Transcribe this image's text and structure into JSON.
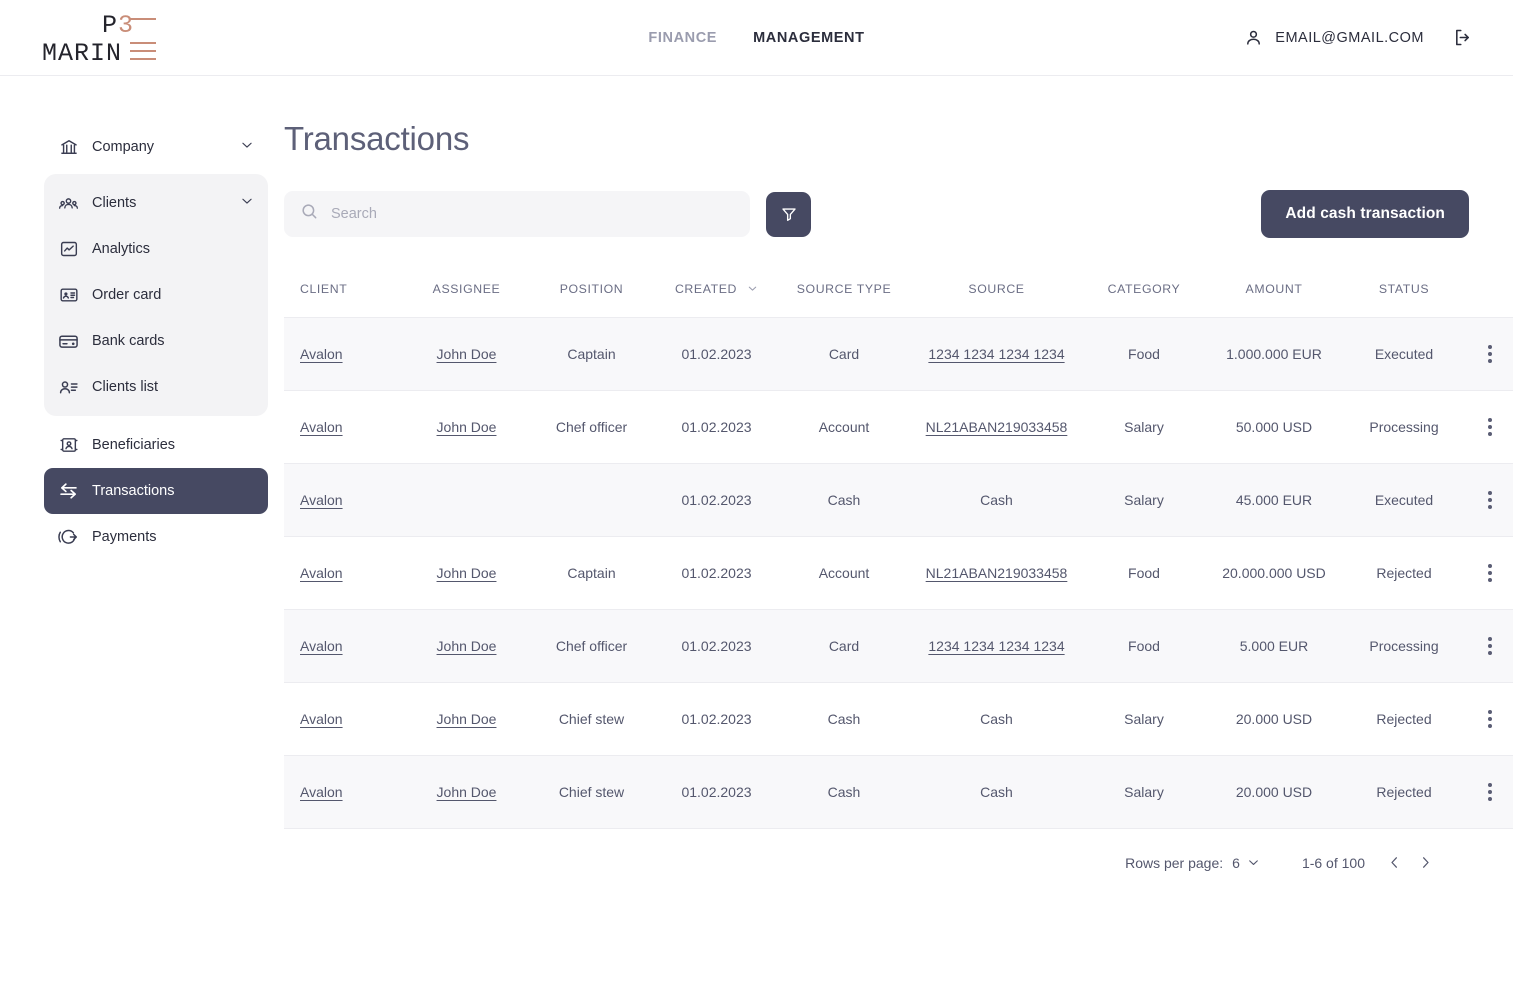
{
  "header": {
    "logo": {
      "top_text": "P3",
      "top_plain": "P",
      "top_accent": "3",
      "bottom_text": "MARIN",
      "accent_color": "#c98d78"
    },
    "nav": [
      {
        "label": "FINANCE",
        "active": false
      },
      {
        "label": "MANAGEMENT",
        "active": true
      }
    ],
    "user_email": "EMAIL@GMAIL.COM",
    "logout_icon": "logout-icon",
    "user_icon": "person-icon"
  },
  "sidebar": {
    "items": [
      {
        "label": "Company",
        "icon": "bank-icon",
        "expandable": true,
        "active": false
      },
      {
        "label": "Clients",
        "icon": "people-icon",
        "expandable": true,
        "active": false,
        "group": true
      },
      {
        "label": "Analytics",
        "icon": "analytics-icon",
        "expandable": false,
        "active": false,
        "group": true
      },
      {
        "label": "Order card",
        "icon": "id-card-icon",
        "expandable": false,
        "active": false,
        "group": true
      },
      {
        "label": "Bank cards",
        "icon": "credit-card-icon",
        "expandable": false,
        "active": false,
        "group": true
      },
      {
        "label": "Clients list",
        "icon": "user-list-icon",
        "expandable": false,
        "active": false,
        "group": true
      },
      {
        "label": "Beneficiaries",
        "icon": "beneficiary-icon",
        "expandable": false,
        "active": false
      },
      {
        "label": "Transactions",
        "icon": "transfer-icon",
        "expandable": false,
        "active": true
      },
      {
        "label": "Payments",
        "icon": "payments-icon",
        "expandable": false,
        "active": false
      }
    ]
  },
  "main": {
    "title": "Transactions",
    "search": {
      "placeholder": "Search",
      "value": "",
      "icon": "search-icon"
    },
    "filter_button": {
      "icon": "filter-icon"
    },
    "add_button": {
      "label": "Add cash transaction"
    },
    "table": {
      "columns": [
        {
          "key": "client",
          "label": "CLIENT",
          "sortable": false
        },
        {
          "key": "assignee",
          "label": "ASSIGNEE",
          "sortable": false
        },
        {
          "key": "position",
          "label": "POSITION",
          "sortable": false
        },
        {
          "key": "created",
          "label": "CREATED",
          "sortable": true
        },
        {
          "key": "source_type",
          "label": "SOURCE TYPE",
          "sortable": false
        },
        {
          "key": "source",
          "label": "SOURCE",
          "sortable": false
        },
        {
          "key": "category",
          "label": "CATEGORY",
          "sortable": false
        },
        {
          "key": "amount",
          "label": "AMOUNT",
          "sortable": false
        },
        {
          "key": "status",
          "label": "STATUS",
          "sortable": false
        }
      ],
      "rows": [
        {
          "client": "Avalon",
          "client_link": true,
          "assignee": "John Doe",
          "assignee_link": true,
          "position": "Captain",
          "created": "01.02.2023",
          "source_type": "Card",
          "source": "1234 1234 1234 1234",
          "source_link": true,
          "category": "Food",
          "amount": "1.000.000 EUR",
          "status": "Executed"
        },
        {
          "client": "Avalon",
          "client_link": true,
          "assignee": "John Doe",
          "assignee_link": true,
          "position": "Chef officer",
          "created": "01.02.2023",
          "source_type": "Account",
          "source": "NL21ABAN219033458",
          "source_link": true,
          "category": "Salary",
          "amount": "50.000 USD",
          "status": "Processing"
        },
        {
          "client": "Avalon",
          "client_link": true,
          "assignee": "",
          "assignee_link": false,
          "position": "",
          "created": "01.02.2023",
          "source_type": "Cash",
          "source": "Cash",
          "source_link": false,
          "category": "Salary",
          "amount": "45.000 EUR",
          "status": "Executed"
        },
        {
          "client": "Avalon",
          "client_link": true,
          "assignee": "John Doe",
          "assignee_link": true,
          "position": "Captain",
          "created": "01.02.2023",
          "source_type": "Account",
          "source": "NL21ABAN219033458",
          "source_link": true,
          "category": "Food",
          "amount": "20.000.000 USD",
          "status": "Rejected"
        },
        {
          "client": "Avalon",
          "client_link": true,
          "assignee": "John Doe",
          "assignee_link": true,
          "position": "Chef officer",
          "created": "01.02.2023",
          "source_type": "Card",
          "source": "1234 1234 1234 1234",
          "source_link": true,
          "category": "Food",
          "amount": "5.000 EUR",
          "status": "Processing"
        },
        {
          "client": "Avalon",
          "client_link": true,
          "assignee": "John Doe",
          "assignee_link": true,
          "position": "Chief stew",
          "created": "01.02.2023",
          "source_type": "Cash",
          "source": "Cash",
          "source_link": false,
          "category": "Salary",
          "amount": "20.000 USD",
          "status": "Rejected"
        },
        {
          "client": "Avalon",
          "client_link": true,
          "assignee": "John Doe",
          "assignee_link": true,
          "position": "Chief stew",
          "created": "01.02.2023",
          "source_type": "Cash",
          "source": "Cash",
          "source_link": false,
          "category": "Salary",
          "amount": "20.000 USD",
          "status": "Rejected"
        }
      ],
      "row_action_icon": "kebab-menu-icon"
    },
    "pagination": {
      "rows_per_page_label": "Rows per page:",
      "rows_per_page_value": "6",
      "range_label": "1-6 of 100",
      "prev_icon": "chevron-left-icon",
      "next_icon": "chevron-right-icon"
    }
  },
  "colors": {
    "accent_dark": "#464962",
    "logo_accent": "#c98d78",
    "row_alt": "#f8f8fa",
    "text": "#54576d"
  }
}
